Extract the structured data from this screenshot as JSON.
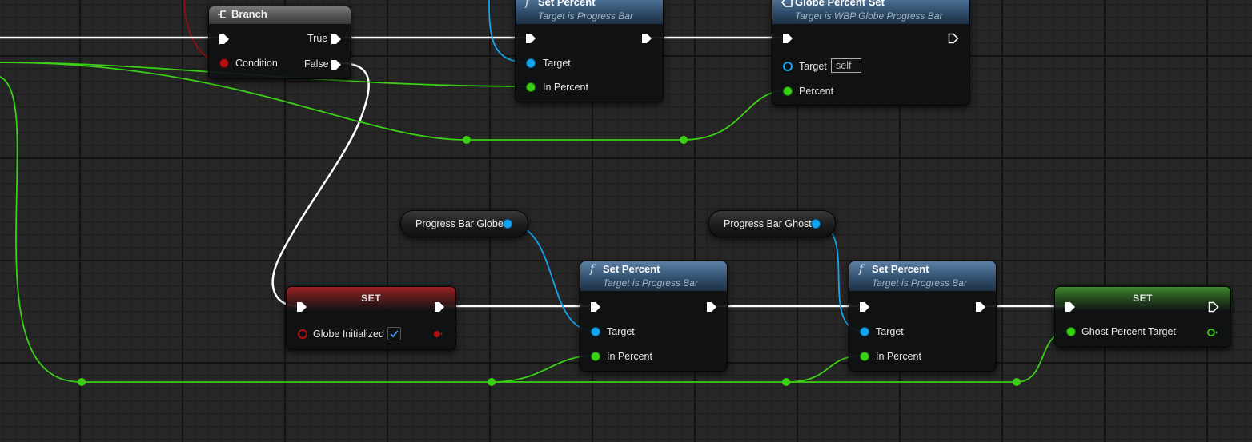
{
  "nodes": {
    "branch": {
      "title": "Branch",
      "true_label": "True",
      "false_label": "False",
      "condition_label": "Condition"
    },
    "set_percent_top": {
      "title": "Set Percent",
      "subtitle": "Target is Progress Bar",
      "target_label": "Target",
      "in_percent_label": "In Percent"
    },
    "globe_percent_set": {
      "title": "Globe Percent Set",
      "subtitle": "Target is WBP Globe Progress Bar",
      "target_label": "Target",
      "target_value": "self",
      "percent_label": "Percent"
    },
    "progress_bar_globe": {
      "label": "Progress Bar Globe"
    },
    "progress_bar_ghost": {
      "label": "Progress Bar Ghost"
    },
    "set_globe_initialized": {
      "title": "SET",
      "var_label": "Globe Initialized",
      "checked": true
    },
    "set_percent_globe": {
      "title": "Set Percent",
      "subtitle": "Target is Progress Bar",
      "target_label": "Target",
      "in_percent_label": "In Percent"
    },
    "set_percent_ghost": {
      "title": "Set Percent",
      "subtitle": "Target is Progress Bar",
      "target_label": "Target",
      "in_percent_label": "In Percent"
    },
    "set_ghost_percent": {
      "title": "SET",
      "var_label": "Ghost Percent Target"
    }
  },
  "colors": {
    "exec_wire": "#ffffff",
    "float_wire": "#3ad016",
    "object_wire": "#15a5f0",
    "bool_wire": "#b01212",
    "function_header": "#3c5f82",
    "set_bool_header": "#9e1f1f",
    "set_float_header": "#3f8a2e"
  }
}
